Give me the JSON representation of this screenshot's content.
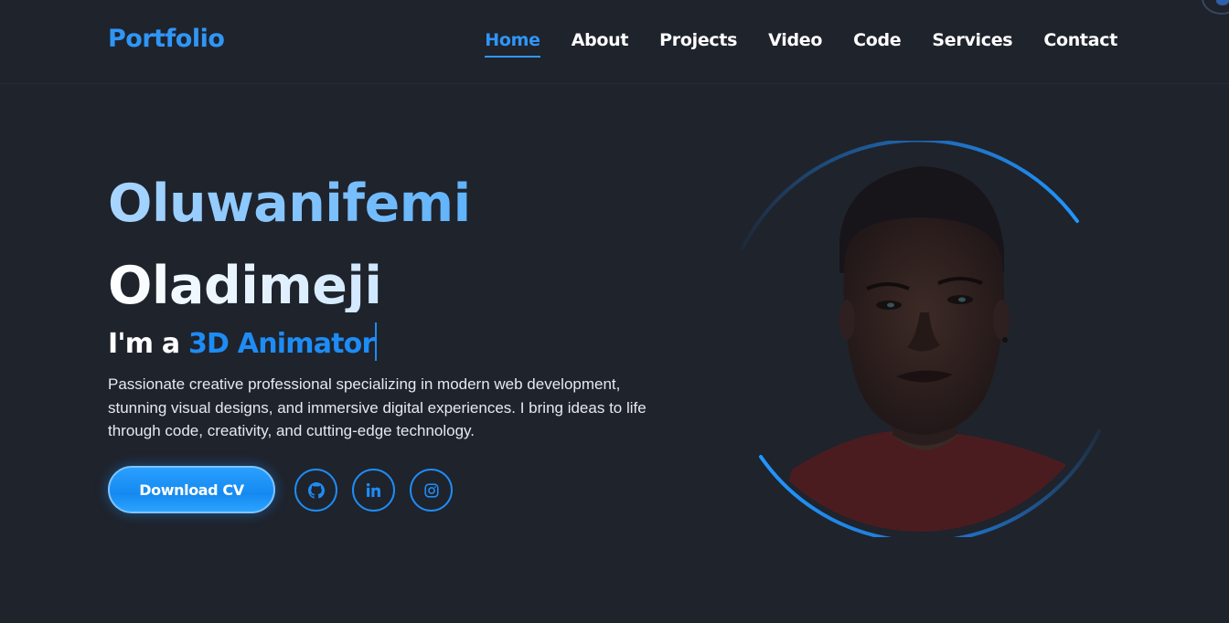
{
  "nav": {
    "brand": "Portfolio",
    "links": [
      {
        "label": "Home",
        "active": true
      },
      {
        "label": "About",
        "active": false
      },
      {
        "label": "Projects",
        "active": false
      },
      {
        "label": "Video",
        "active": false
      },
      {
        "label": "Code",
        "active": false
      },
      {
        "label": "Services",
        "active": false
      },
      {
        "label": "Contact",
        "active": false
      }
    ]
  },
  "hero": {
    "first_name": "Oluwanifemi",
    "last_name": "Oladimeji",
    "role_prefix": "I'm a",
    "role": "3D Animator",
    "description": "Passionate creative professional specializing in modern web development, stunning visual designs, and immersive digital experiences. I bring ideas to life through code, creativity, and cutting-edge technology.",
    "cv_button": "Download CV",
    "socials": [
      {
        "name": "github",
        "icon": "github-icon"
      },
      {
        "name": "linkedin",
        "icon": "linkedin-icon"
      },
      {
        "name": "instagram",
        "icon": "instagram-icon"
      }
    ]
  },
  "colors": {
    "background": "#1f232c",
    "accent": "#1e8cf5",
    "text": "#ffffff"
  }
}
